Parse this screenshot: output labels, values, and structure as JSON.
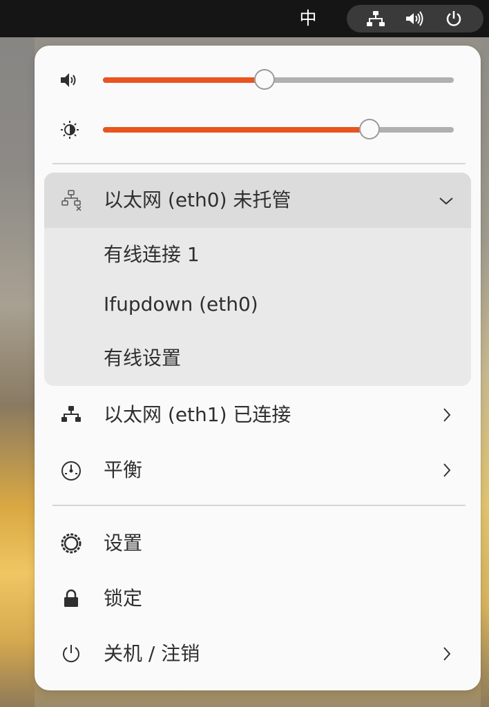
{
  "topbar": {
    "ime_label": "中",
    "tray_icons": [
      "network-icon",
      "volume-icon",
      "power-icon"
    ]
  },
  "colors": {
    "accent": "#e95420",
    "menu_bg": "#fafafa",
    "submenu_bg": "#e9e9e9",
    "submenu_header_bg": "#dcdcdc",
    "topbar_bg": "#151515"
  },
  "menu": {
    "volume": {
      "icon": "volume-icon",
      "value_percent": 46
    },
    "brightness": {
      "icon": "brightness-icon",
      "value_percent": 76
    },
    "ethernet_eth0": {
      "label": "以太网 (eth0) 未托管",
      "icon": "network-unmanaged-icon",
      "expanded": true,
      "items": [
        {
          "label": "有线连接 1"
        },
        {
          "label": "Ifupdown (eth0)"
        },
        {
          "label": "有线设置"
        }
      ]
    },
    "ethernet_eth1": {
      "label": "以太网 (eth1) 已连接",
      "icon": "network-icon"
    },
    "power_mode": {
      "label": "平衡",
      "icon": "power-profile-icon"
    },
    "settings": {
      "label": "设置",
      "icon": "settings-icon"
    },
    "lock": {
      "label": "锁定",
      "icon": "lock-icon"
    },
    "power_off": {
      "label": "关机 / 注销",
      "icon": "power-icon"
    }
  }
}
